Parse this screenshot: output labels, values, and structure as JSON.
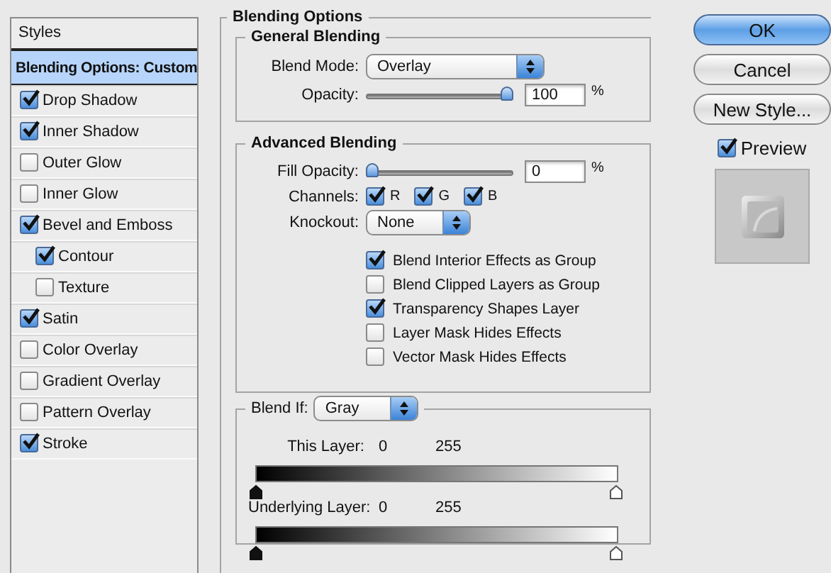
{
  "sidebar": {
    "title": "Styles",
    "items": [
      {
        "label": "Blending Options: Custom",
        "kind": "header",
        "selected": true
      },
      {
        "label": "Drop Shadow",
        "kind": "effect",
        "checked": true,
        "selected": false
      },
      {
        "label": "Inner Shadow",
        "kind": "effect",
        "checked": true,
        "selected": false
      },
      {
        "label": "Outer Glow",
        "kind": "effect",
        "checked": false,
        "selected": false
      },
      {
        "label": "Inner Glow",
        "kind": "effect",
        "checked": false,
        "selected": false
      },
      {
        "label": "Bevel and Emboss",
        "kind": "effect",
        "checked": true,
        "selected": false,
        "children": [
          {
            "label": "Contour",
            "kind": "effect",
            "checked": true,
            "selected": false
          },
          {
            "label": "Texture",
            "kind": "effect",
            "checked": false,
            "selected": false
          }
        ]
      },
      {
        "label": "Satin",
        "kind": "effect",
        "checked": true,
        "selected": false
      },
      {
        "label": "Color Overlay",
        "kind": "effect",
        "checked": false,
        "selected": false
      },
      {
        "label": "Gradient Overlay",
        "kind": "effect",
        "checked": false,
        "selected": false
      },
      {
        "label": "Pattern Overlay",
        "kind": "effect",
        "checked": false,
        "selected": false
      },
      {
        "label": "Stroke",
        "kind": "effect",
        "checked": true,
        "selected": false
      }
    ]
  },
  "blending_options": {
    "title": "Blending Options",
    "general": {
      "title": "General Blending",
      "blend_mode": {
        "label": "Blend Mode:",
        "value": "Overlay"
      },
      "opacity": {
        "label": "Opacity:",
        "level": 1,
        "value": "100",
        "unit": "%"
      }
    },
    "advanced": {
      "title": "Advanced Blending",
      "fill_opacity": {
        "label": "Fill Opacity:",
        "level": 0,
        "value": "0",
        "unit": "%"
      },
      "channels": {
        "label": "Channels:",
        "items": [
          {
            "label": "R",
            "checked": true
          },
          {
            "label": "G",
            "checked": true
          },
          {
            "label": "B",
            "checked": true
          }
        ]
      },
      "knockout": {
        "label": "Knockout:",
        "value": "None"
      },
      "options": [
        {
          "label": "Blend Interior Effects as Group",
          "checked": true
        },
        {
          "label": "Blend Clipped Layers as Group",
          "checked": false
        },
        {
          "label": "Transparency Shapes Layer",
          "checked": true
        },
        {
          "label": "Layer Mask Hides Effects",
          "checked": false
        },
        {
          "label": "Vector Mask Hides Effects",
          "checked": false
        }
      ]
    },
    "blend_if": {
      "label": "Blend If:",
      "value": "Gray",
      "layers": [
        {
          "label": "This Layer:",
          "low": "0",
          "high": "255"
        },
        {
          "label": "Underlying Layer:",
          "low": "0",
          "high": "255"
        }
      ]
    }
  },
  "buttons": [
    {
      "label": "OK",
      "default": true
    },
    {
      "label": "Cancel",
      "default": false
    },
    {
      "label": "New Style...",
      "default": false
    }
  ],
  "preview": {
    "label": "Preview",
    "checked": true
  }
}
